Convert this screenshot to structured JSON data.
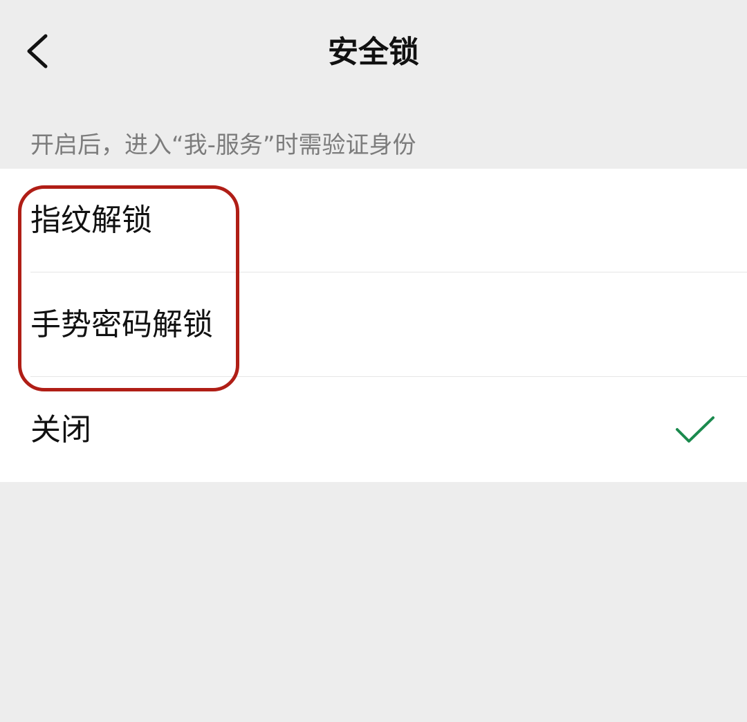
{
  "nav": {
    "title": "安全锁",
    "back_icon": "chevron-left-icon"
  },
  "caption": "开启后，进入“我-服务”时需验证身份",
  "options": [
    {
      "label": "指纹解锁",
      "selected": false
    },
    {
      "label": "手势密码解锁",
      "selected": false
    },
    {
      "label": "关闭",
      "selected": true
    }
  ],
  "check_icon": "checkmark-icon",
  "colors": {
    "background": "#ededed",
    "card": "#ffffff",
    "caption": "#7c7c7c",
    "check": "#1b8a4e",
    "highlight": "#b01e16"
  }
}
